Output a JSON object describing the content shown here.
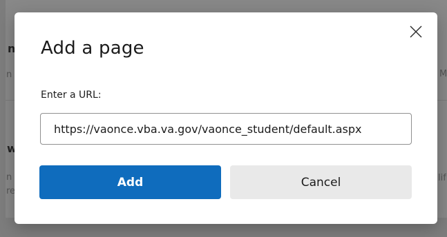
{
  "dialog": {
    "title": "Add a page",
    "url_label": "Enter a URL:",
    "url_value": "https://vaonce.vba.va.gov/vaonce_student/default.aspx",
    "add_label": "Add",
    "cancel_label": "Cancel",
    "close_icon": "close-icon"
  },
  "background_fragments": {
    "frag_1": "n",
    "frag_2": "n",
    "frag_3": "M",
    "frag_4": "w",
    "frag_5": "n",
    "frag_6": "lif",
    "frag_7": "re"
  },
  "colors": {
    "primary": "#0f6cbd",
    "secondary": "#e9e9e9",
    "overlay": "#8a8a8a"
  }
}
